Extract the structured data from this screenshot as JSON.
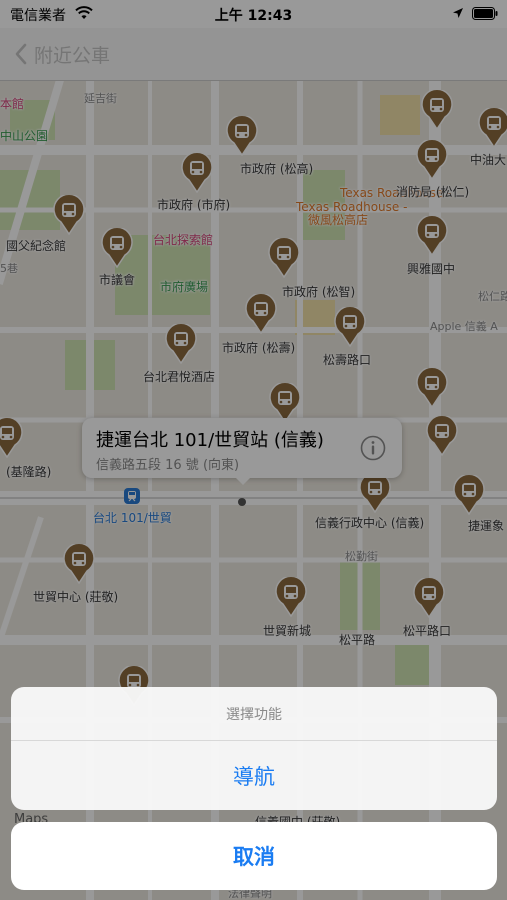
{
  "status_bar": {
    "carrier": "電信業者",
    "time": "上午 12:43"
  },
  "nav": {
    "title": "附近公車"
  },
  "map": {
    "labels": {
      "shop_partial": "本館",
      "zhongshan_park": "中山公園",
      "road_vertical": "延吉街",
      "sun_yat_sen_hall": "國父紀念館",
      "lane5": "5巷",
      "lane_left": "5巷",
      "city_council": "市議會",
      "city_plaza": "市府廣場",
      "discovery_center": "台北探索館",
      "texas_roadhouse_en": "Texas Roadhouse -",
      "texas_roadhouse_cn": "微風松高店",
      "stop_songgao": "市政府 (松高)",
      "stop_shifu": "市政府 (市府)",
      "stop_fire_bureau": "消防局 (松仁)",
      "stop_zhongyou": "中油大",
      "stop_xingya": "興雅國中",
      "stop_songzhi": "市政府 (松智)",
      "songren_road": "松仁路",
      "apple_xinyi": "Apple 信義 A",
      "stop_songshou": "市政府 (松壽)",
      "stop_songshou_road": "松壽路口",
      "grand_hyatt": "台北君悅酒店",
      "stop_keelung": "(基隆路)",
      "mrt_station": "台北 101/世貿",
      "stop_xinyi_admin": "信義行政中心 (信義)",
      "stop_mrt_right": "捷運象",
      "songgao_road": "松勤街",
      "stop_wtc_zhuangjing": "世貿中心 (莊敬)",
      "stop_wtc_xincheng": "世貿新城",
      "stop_songping": "松平路",
      "stop_songping_road": "松平路口",
      "stop_xinyi_junior": "信義國中 (莊敬)",
      "legal_link": "法律聲明",
      "maps_logo": "Maps"
    }
  },
  "callout": {
    "title": "捷運台北 101/世貿站 (信義)",
    "subtitle": "信義路五段 16 號 (向東)"
  },
  "action_sheet": {
    "title": "選擇功能",
    "action": "導航",
    "cancel": "取消"
  },
  "colors": {
    "accent": "#1a7cf2",
    "pin": "#8b6a3e",
    "dim": "rgba(0,0,0,0.4)"
  },
  "icons": {
    "back": "chevron-left-icon",
    "wifi": "wifi-icon",
    "location": "location-arrow-icon",
    "battery": "battery-icon",
    "bus": "bus-stop-icon",
    "info": "info-icon",
    "metro": "metro-icon"
  }
}
